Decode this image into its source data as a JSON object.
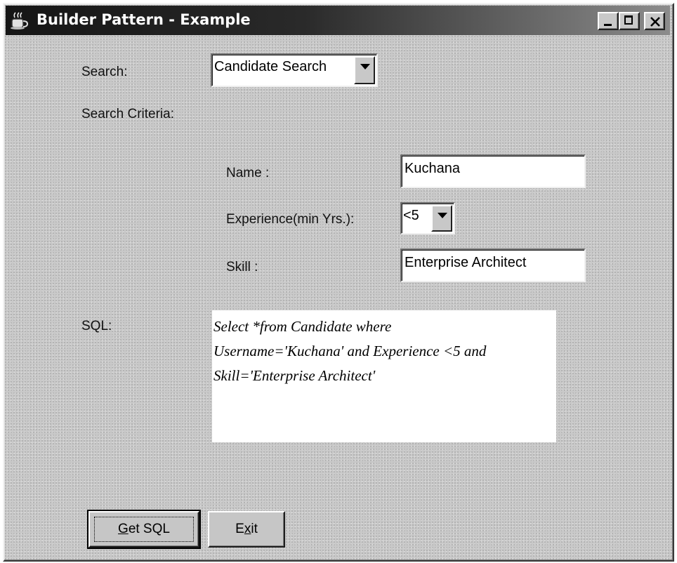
{
  "window": {
    "title": "Builder Pattern - Example",
    "title_bar_gradient": [
      "#151515",
      "#8c8c8c"
    ],
    "controls": {
      "minimize": "minimize-icon",
      "maximize": "maximize-icon",
      "close": "close-icon"
    }
  },
  "search": {
    "label": "Search:",
    "selected": "Candidate Search"
  },
  "criteria": {
    "label": "Search Criteria:",
    "name_label": "Name :",
    "name_value": "Kuchana",
    "experience_label": "Experience(min Yrs.):",
    "experience_selected": "<5",
    "skill_label": "Skill :",
    "skill_value": "Enterprise Architect"
  },
  "sql": {
    "label": "SQL:",
    "lines": [
      "Select *from Candidate where",
      "Username='Kuchana' and Experience <5 and",
      "Skill='Enterprise Architect'"
    ]
  },
  "buttons": {
    "get_sql_pre": "",
    "get_sql_mnemonic": "G",
    "get_sql_post": "et SQL",
    "exit_pre": "E",
    "exit_mnemonic": "x",
    "exit_post": "it"
  }
}
